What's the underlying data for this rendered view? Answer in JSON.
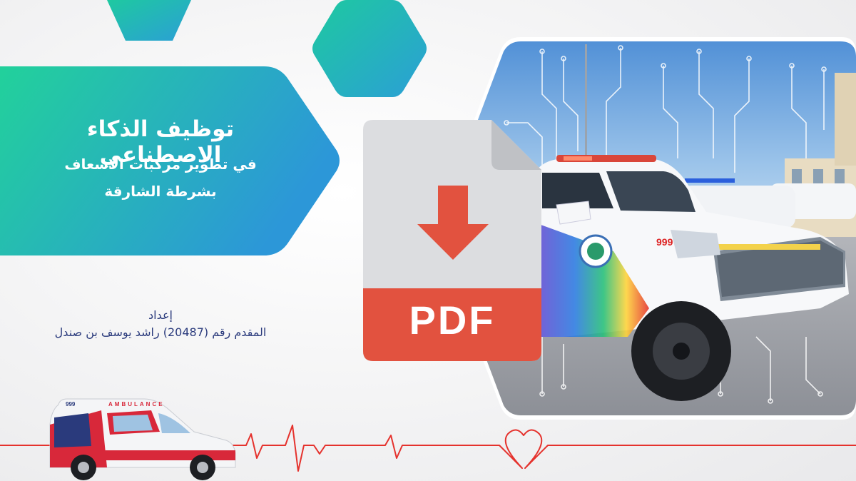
{
  "title": {
    "line1": "توظيف الذكاء الاصطناعي",
    "line2": "في تطوير مركبات الاسعاف",
    "line3": "بشرطة الشارقة"
  },
  "author": {
    "label": "إعداد",
    "name": "المقدم رقم (20487) راشد يوسف بن صندل"
  },
  "pdf_icon": {
    "text": "PDF",
    "icon": "download-arrow-icon"
  },
  "vehicle": {
    "number": "999"
  },
  "ambulance": {
    "label": "AMBULANCE",
    "number": "999"
  },
  "colors": {
    "gradient_start": "#1ec9a0",
    "gradient_end": "#2b9fd6",
    "pdf_red": "#e2523f",
    "ecg_red": "#e5322d",
    "author_text": "#2a3a7c"
  }
}
